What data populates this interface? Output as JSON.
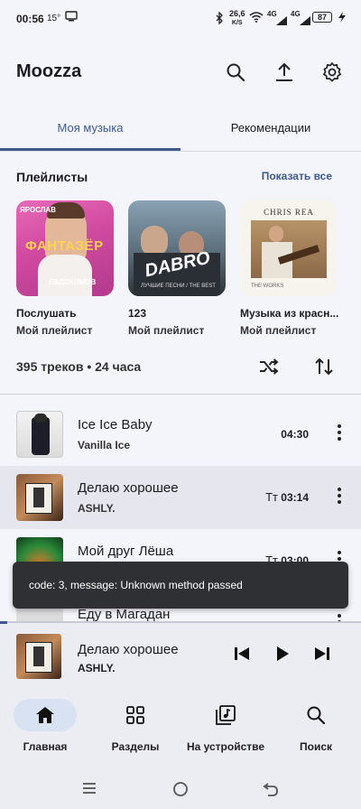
{
  "status_bar": {
    "time": "00:56",
    "temperature": "15°",
    "net_speed": "26,6",
    "net_unit": "K/S",
    "signal1": "4G",
    "signal2": "4G",
    "battery": "87"
  },
  "app": {
    "title": "Moozza",
    "icons": [
      "search-icon",
      "upload-icon",
      "settings-icon"
    ]
  },
  "tabs": [
    {
      "label": "Моя музыка",
      "active": true
    },
    {
      "label": "Рекомендации",
      "active": false
    }
  ],
  "playlists_section": {
    "title": "Плейлисты",
    "show_all": "Показать все",
    "items": [
      {
        "name": "Послушать",
        "subtitle": "Мой плейлист",
        "art_text_top": "ЯРОСЛАВ",
        "art_text_mid": "ФАНТАЗЁР",
        "art_text_bot": "ЕВДОКИМОВ"
      },
      {
        "name": "123",
        "subtitle": "Мой плейлист",
        "art_text_mid": "DABRO",
        "art_text_bot": "ЛУЧШИЕ ПЕСНИ / THE BEST"
      },
      {
        "name": "Музыка из красн...",
        "subtitle": "Мой плейлист",
        "art_text_top": "CHRIS REA",
        "art_text_bot": "THE WORKS"
      }
    ]
  },
  "stats": "395 треков • 24 часа",
  "tracks": [
    {
      "title": "Ice Ice Baby",
      "artist": "Vanilla Ice",
      "duration": "04:30",
      "lyrics": "",
      "playing": false
    },
    {
      "title": "Делаю хорошее",
      "artist": "ASHLY.",
      "duration": "03:14",
      "lyrics": "Тт",
      "playing": true
    },
    {
      "title": "Мой друг Лёша",
      "artist": "",
      "duration": "03:00",
      "lyrics": "Тт",
      "playing": false
    },
    {
      "title": "Еду в Магадан",
      "artist": "",
      "duration": "",
      "lyrics": "",
      "playing": false
    }
  ],
  "toast": "code: 3, message: Unknown method passed",
  "mini_player": {
    "title": "Делаю хорошее",
    "artist": "ASHLY.",
    "progress": 0.02
  },
  "bottom_nav": [
    {
      "label": "Главная",
      "icon": "home-icon",
      "active": true
    },
    {
      "label": "Разделы",
      "icon": "grid-icon",
      "active": false
    },
    {
      "label": "На устройстве",
      "icon": "device-music-icon",
      "active": false
    },
    {
      "label": "Поиск",
      "icon": "search-icon",
      "active": false
    }
  ],
  "colors": {
    "accent": "#3d5a8a",
    "background": "#f4f4fb",
    "toast_bg": "#2f3033"
  }
}
